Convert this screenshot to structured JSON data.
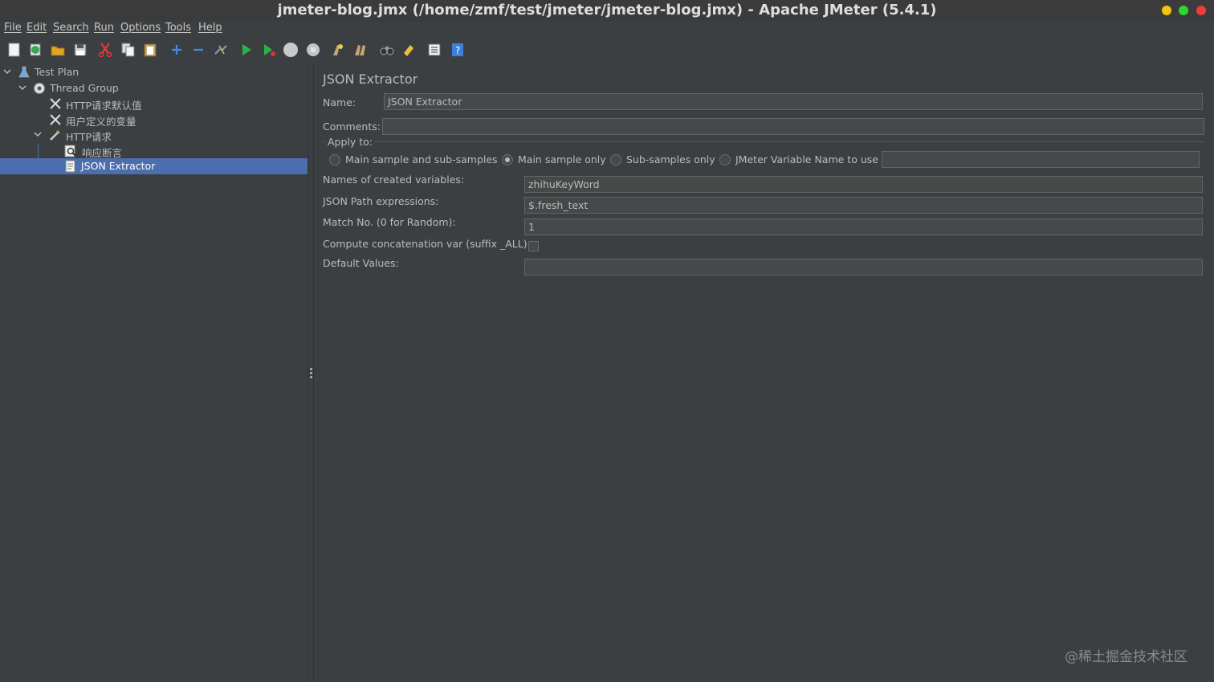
{
  "window": {
    "title": "jmeter-blog.jmx (/home/zmf/test/jmeter/jmeter-blog.jmx) - Apache JMeter (5.4.1)"
  },
  "menu": [
    "File",
    "Edit",
    "Search",
    "Run",
    "Options",
    "Tools",
    "Help"
  ],
  "toolbar": {
    "icons": [
      "new-icon",
      "templates-icon",
      "open-icon",
      "save-icon",
      "cut-icon",
      "copy-icon",
      "paste-icon",
      "expand-icon",
      "collapse-icon",
      "toggle-icon",
      "start-icon",
      "start-no-pauses-icon",
      "stop-icon",
      "shutdown-icon",
      "clear-icon",
      "clear-all-icon",
      "search-icon",
      "reset-search-icon",
      "function-helper-icon",
      "help-icon"
    ]
  },
  "tree": {
    "items": [
      {
        "label": "Test Plan",
        "icon": "test-plan-icon"
      },
      {
        "label": "Thread Group",
        "icon": "thread-group-icon"
      },
      {
        "label": "HTTP请求默认值",
        "icon": "config-element-icon"
      },
      {
        "label": "用户定义的变量",
        "icon": "config-element-icon"
      },
      {
        "label": "HTTP请求",
        "icon": "sampler-icon"
      },
      {
        "label": "响应断言",
        "icon": "assertion-icon"
      },
      {
        "label": "JSON Extractor",
        "icon": "post-processor-icon"
      }
    ]
  },
  "panel": {
    "title": "JSON Extractor",
    "name_label": "Name:",
    "name_value": "JSON Extractor",
    "comments_label": "Comments:",
    "comments_value": "",
    "apply_to_label": "Apply to:",
    "apply_options": [
      "Main sample and sub-samples",
      "Main sample only",
      "Sub-samples only",
      "JMeter Variable Name to use"
    ],
    "apply_selected": "Main sample only",
    "jmeter_var_value": "",
    "names_label": "Names of created variables:",
    "names_value": "zhihuKeyWord",
    "jsonpath_label": "JSON Path expressions:",
    "jsonpath_value": "$.fresh_text",
    "match_label": "Match No. (0 for Random):",
    "match_value": "1",
    "concat_label": "Compute concatenation var (suffix _ALL):",
    "concat_checked": false,
    "default_label": "Default Values:",
    "default_value": ""
  },
  "watermark": "@稀土掘金技术社区",
  "colors": {
    "background": "#3c3f41",
    "selection": "#4b6eaf",
    "text": "#bbbbbb"
  }
}
